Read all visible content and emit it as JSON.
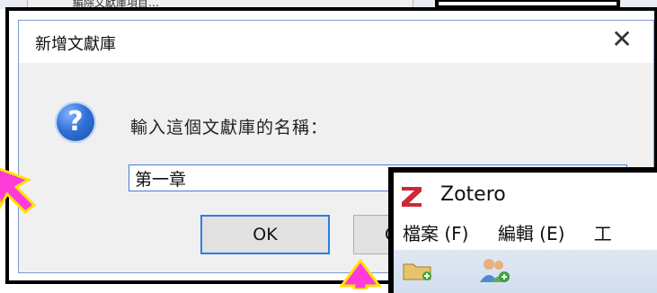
{
  "background": {
    "menu_fragment": "編除文獻庫項目…"
  },
  "dialog": {
    "title": "新增文獻庫",
    "close_symbol": "✕",
    "prompt": "輸入這個文獻庫的名稱：",
    "input_value": "第一章",
    "ok_label": "OK",
    "cancel_label_visible": "C"
  },
  "zotero": {
    "title": "Zotero",
    "menu": {
      "file": "檔案 (F)",
      "edit": "編輯 (E)",
      "tools_partial": "工"
    }
  },
  "colors": {
    "annotation_arrow": "#ff3bd9",
    "annotation_outline": "#ffe400",
    "zotero_brand": "#cc2936",
    "focus_border": "#2d7fe0"
  },
  "icons": {
    "question": "question-mark-icon",
    "close": "close-icon",
    "new_collection": "folder-add-icon",
    "new_group": "group-add-icon"
  }
}
